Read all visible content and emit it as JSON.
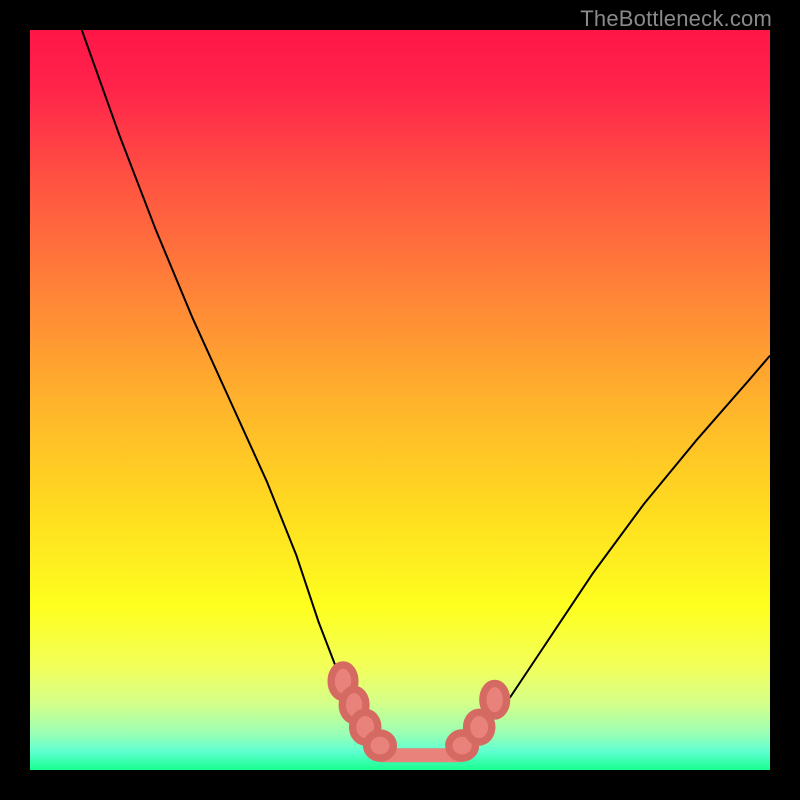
{
  "watermark": "TheBottleneck.com",
  "chart_data": {
    "type": "line",
    "title": "",
    "xlabel": "",
    "ylabel": "",
    "xlim": [
      0,
      100
    ],
    "ylim": [
      0,
      100
    ],
    "background_gradient_stops": [
      {
        "pos": 0.0,
        "color": "#ff1648"
      },
      {
        "pos": 0.08,
        "color": "#ff244a"
      },
      {
        "pos": 0.2,
        "color": "#ff5142"
      },
      {
        "pos": 0.35,
        "color": "#ff8238"
      },
      {
        "pos": 0.5,
        "color": "#ffb22c"
      },
      {
        "pos": 0.65,
        "color": "#ffdc20"
      },
      {
        "pos": 0.78,
        "color": "#feff1f"
      },
      {
        "pos": 0.86,
        "color": "#f3ff5a"
      },
      {
        "pos": 0.91,
        "color": "#d4ff8a"
      },
      {
        "pos": 0.95,
        "color": "#9cffb4"
      },
      {
        "pos": 0.975,
        "color": "#5fffd0"
      },
      {
        "pos": 1.0,
        "color": "#18ff8f"
      }
    ],
    "series": [
      {
        "name": "left-branch",
        "x": [
          7,
          12,
          17,
          22,
          27,
          32,
          36,
          39,
          41.5,
          43.5,
          45.2,
          46.5
        ],
        "y": [
          100,
          86,
          73,
          61,
          50,
          39,
          29,
          20,
          13.5,
          8.5,
          5.0,
          3.0
        ]
      },
      {
        "name": "flat-bottom",
        "x": [
          46.5,
          58.5
        ],
        "y": [
          2.0,
          2.0
        ]
      },
      {
        "name": "right-branch",
        "x": [
          58.5,
          61,
          65,
          70,
          76,
          83,
          90,
          97,
          100
        ],
        "y": [
          3.0,
          5.0,
          10.0,
          17.5,
          26.5,
          36.0,
          44.5,
          52.5,
          56.0
        ]
      }
    ],
    "markers": [
      {
        "x": 42.3,
        "y": 12.0,
        "rx": 1.6,
        "ry": 2.2
      },
      {
        "x": 43.8,
        "y": 8.8,
        "rx": 1.6,
        "ry": 2.1
      },
      {
        "x": 45.3,
        "y": 5.8,
        "rx": 1.7,
        "ry": 2.0
      },
      {
        "x": 47.3,
        "y": 3.3,
        "rx": 1.8,
        "ry": 1.7
      },
      {
        "x": 58.4,
        "y": 3.3,
        "rx": 1.8,
        "ry": 1.7
      },
      {
        "x": 60.7,
        "y": 5.8,
        "rx": 1.7,
        "ry": 2.0
      },
      {
        "x": 62.8,
        "y": 9.5,
        "rx": 1.6,
        "ry": 2.2
      }
    ],
    "flat_segment": {
      "x1": 47.5,
      "y": 2.0,
      "x2": 58.0
    }
  }
}
